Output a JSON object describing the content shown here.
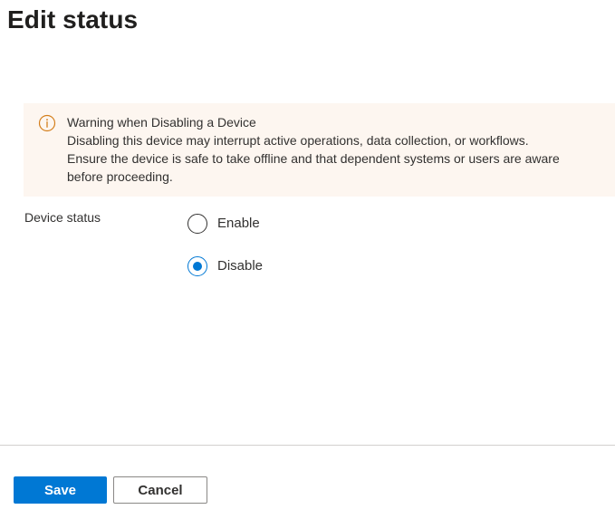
{
  "panel": {
    "title": "Edit status"
  },
  "warning": {
    "icon": "info-icon",
    "accent_color": "#d47e1b",
    "background_color": "#fdf6f0",
    "title": "Warning when Disabling a Device",
    "lines": [
      "Disabling this device may interrupt active operations, data collection, or workflows.",
      "Ensure the device is safe to take offline and that dependent systems or users are aware",
      "before proceeding."
    ]
  },
  "device_status": {
    "label": "Device status",
    "options": [
      {
        "label": "Enable",
        "selected": false
      },
      {
        "label": "Disable",
        "selected": true
      }
    ],
    "accent_color": "#0078d4"
  },
  "footer": {
    "save_label": "Save",
    "cancel_label": "Cancel"
  }
}
